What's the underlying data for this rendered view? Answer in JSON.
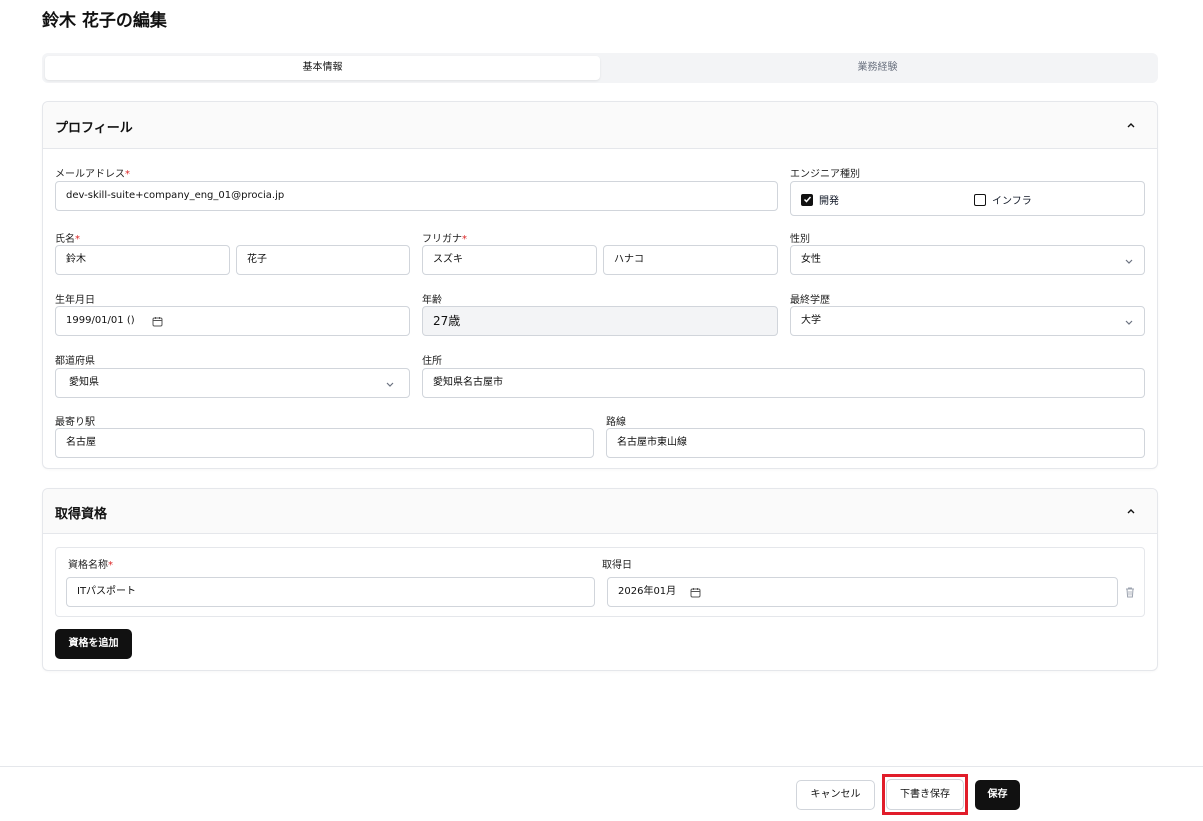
{
  "page": {
    "title": "鈴木 花子の編集"
  },
  "tabs": [
    {
      "label": "基本情報",
      "active": true
    },
    {
      "label": "業務経験",
      "active": false
    }
  ],
  "profile": {
    "title": "プロフィール",
    "email": {
      "label": "メールアドレス",
      "required": "*",
      "value": "dev-skill-suite+company_eng_01@procia.jp"
    },
    "engineer_type": {
      "label": "エンジニア種別",
      "options": [
        {
          "label": "開発",
          "checked": true
        },
        {
          "label": "インフラ",
          "checked": false
        }
      ]
    },
    "name": {
      "label": "氏名",
      "required": "*",
      "last": "鈴木",
      "first": "花子"
    },
    "furigana": {
      "label": "フリガナ",
      "required": "*",
      "last": "スズキ",
      "first": "ハナコ"
    },
    "gender": {
      "label": "性別",
      "value": "女性"
    },
    "birthdate": {
      "label": "生年月日",
      "value": "1999/01/01 ()"
    },
    "age": {
      "label": "年齢",
      "value": "27歳"
    },
    "education": {
      "label": "最終学歴",
      "value": "大学"
    },
    "prefecture": {
      "label": "都道府県",
      "value": "愛知県"
    },
    "address": {
      "label": "住所",
      "value": "愛知県名古屋市"
    },
    "station": {
      "label": "最寄り駅",
      "value": "名古屋"
    },
    "line": {
      "label": "路線",
      "value": "名古屋市東山線"
    }
  },
  "qualifications": {
    "title": "取得資格",
    "name_label": "資格名称",
    "required": "*",
    "date_label": "取得日",
    "items": [
      {
        "name": "ITパスポート",
        "date": "2026年01月"
      }
    ],
    "add_button": "資格を追加"
  },
  "footer": {
    "cancel": "キャンセル",
    "draft": "下書き保存",
    "save": "保存"
  },
  "colors": {
    "accent": "#111111",
    "required": "#dc2626",
    "highlight": "#e11d2a"
  }
}
